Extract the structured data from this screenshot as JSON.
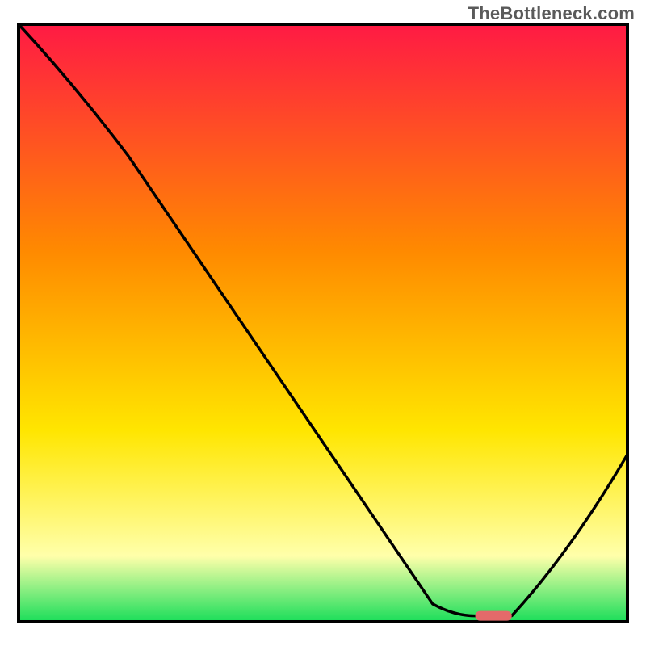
{
  "watermark": "TheBottleneck.com",
  "chart_data": {
    "type": "line",
    "title": "",
    "xlabel": "",
    "ylabel": "",
    "xlim": [
      0,
      100
    ],
    "ylim": [
      0,
      100
    ],
    "grid": false,
    "legend": false,
    "series": [
      {
        "name": "bottleneck-curve",
        "x": [
          0,
          18,
          68,
          75,
          81,
          100
        ],
        "values": [
          100,
          78,
          3,
          1,
          1,
          28
        ],
        "note": "y is percent height above baseline; curve dips from top-left, inflects near x≈18, drops to a flat minimum around x≈75–81, then rises to x=100"
      }
    ],
    "marker": {
      "name": "optimal-band",
      "x_start": 75,
      "x_end": 81,
      "y": 1,
      "color": "#e46a6a"
    },
    "background_gradient": {
      "top": "#ff1a44",
      "mid1": "#ff8a00",
      "mid2": "#ffe600",
      "mid3": "#ffffaa",
      "bottom": "#1ade5a"
    },
    "colors": {
      "curve": "#000000",
      "frame": "#000000",
      "marker": "#e46a6a"
    }
  }
}
